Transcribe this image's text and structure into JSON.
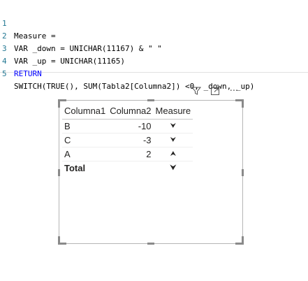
{
  "editor": {
    "lines": [
      {
        "num": "1",
        "text": "Measure ="
      },
      {
        "num": "2",
        "text": "VAR _down = UNICHAR(11167) & \" \""
      },
      {
        "num": "3",
        "text": "VAR _up = UNICHAR(11165)"
      },
      {
        "num": "4",
        "text": "RETURN"
      },
      {
        "num": "5",
        "text": "SWITCH(TRUE(), SUM(Tabla2[Columna2]) <0, _down, _up)"
      }
    ]
  },
  "toolbar": {
    "filter_icon": "filter-icon",
    "focus_icon": "focus-mode-icon",
    "more_icon": "more-options-icon",
    "more_glyph": "···"
  },
  "table": {
    "headers": [
      "Columna1",
      "Columna2",
      "Measure"
    ],
    "rows": [
      {
        "col1": "B",
        "col2": "-10",
        "measure": "⮟"
      },
      {
        "col1": "C",
        "col2": "-3",
        "measure": "⮟"
      },
      {
        "col1": "A",
        "col2": "2",
        "measure": "⮝"
      }
    ],
    "total": {
      "label": "Total",
      "col2": "",
      "measure": "⮟"
    }
  }
}
